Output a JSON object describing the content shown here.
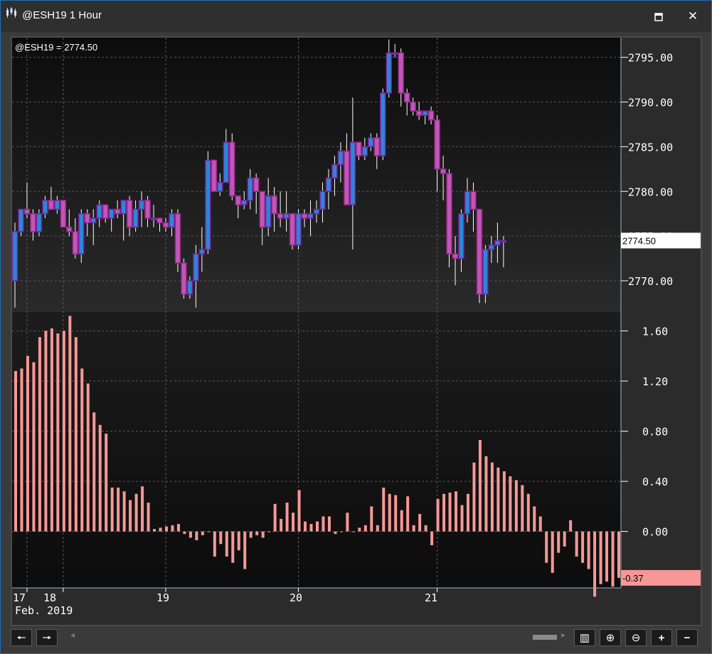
{
  "window": {
    "title": "@ESH19 1 Hour",
    "maximize_glyph": "🗖",
    "close_glyph": "✕",
    "app_icon": "candlestick-app-icon"
  },
  "chart": {
    "symbol_label": "@ESH19 = 2774.50",
    "price_axis_ticks": [
      "2795.00",
      "2790.00",
      "2785.00",
      "2780.00",
      "2775.00",
      "2770.00"
    ],
    "price_marker": "2774.50",
    "indicator_axis_ticks": [
      "1.60",
      "1.20",
      "0.80",
      "0.40",
      "0.00"
    ],
    "indicator_marker": "-0.37",
    "date_labels": [
      "17",
      "18",
      "19",
      "20",
      "21"
    ],
    "month_label": "Feb. 2019",
    "colors": {
      "up_body": "#2c86d9",
      "up_border": "#7a1f9c",
      "down_body": "#c355b8",
      "down_border": "#8f2a85",
      "wick": "#ffffff",
      "histogram": "#f79896",
      "marker_bg": "#ffffff",
      "indicator_marker_bg": "#f79896"
    }
  },
  "chart_data": [
    {
      "type": "candlestick",
      "title": "@ESH19 1 Hour",
      "ylim": [
        2766.5,
        2797.2
      ],
      "last": 2774.5,
      "x_labels": [
        "17",
        "18",
        "19",
        "20",
        "21"
      ],
      "ohlc": [
        [
          2770.0,
          2776.5,
          2767.0,
          2775.5
        ],
        [
          2775.5,
          2778.0,
          2775.0,
          2778.0
        ],
        [
          2778.0,
          2781.0,
          2777.0,
          2777.5
        ],
        [
          2777.5,
          2778.0,
          2774.5,
          2775.5
        ],
        [
          2775.5,
          2778.0,
          2775.0,
          2777.5
        ],
        [
          2777.5,
          2779.5,
          2777.0,
          2779.0
        ],
        [
          2779.0,
          2780.5,
          2778.0,
          2778.0
        ],
        [
          2778.0,
          2779.5,
          2777.5,
          2779.0
        ],
        [
          2779.0,
          2779.0,
          2777.0,
          2776.0
        ],
        [
          2776.0,
          2778.0,
          2775.0,
          2775.5
        ],
        [
          2775.5,
          2777.0,
          2772.5,
          2773.0
        ],
        [
          2773.0,
          2778.0,
          2772.0,
          2777.5
        ],
        [
          2777.5,
          2778.0,
          2775.0,
          2776.5
        ],
        [
          2776.5,
          2778.0,
          2774.0,
          2777.0
        ],
        [
          2777.0,
          2779.0,
          2776.0,
          2778.5
        ],
        [
          2778.5,
          2778.5,
          2776.5,
          2777.0
        ],
        [
          2777.0,
          2778.0,
          2775.5,
          2778.0
        ],
        [
          2778.0,
          2779.0,
          2777.0,
          2777.5
        ],
        [
          2777.5,
          2779.0,
          2774.5,
          2779.0
        ],
        [
          2779.0,
          2779.5,
          2775.0,
          2776.0
        ],
        [
          2776.0,
          2779.0,
          2775.5,
          2778.0
        ],
        [
          2778.0,
          2780.0,
          2776.0,
          2779.0
        ],
        [
          2779.0,
          2779.5,
          2776.0,
          2777.0
        ],
        [
          2777.0,
          2778.5,
          2776.0,
          2777.0
        ],
        [
          2777.0,
          2777.0,
          2775.5,
          2776.5
        ],
        [
          2776.5,
          2777.0,
          2775.5,
          2776.0
        ],
        [
          2776.0,
          2778.0,
          2775.0,
          2777.5
        ],
        [
          2777.5,
          2778.0,
          2771.0,
          2772.0
        ],
        [
          2772.0,
          2772.5,
          2768.0,
          2768.5
        ],
        [
          2768.5,
          2770.5,
          2768.0,
          2770.0
        ],
        [
          2770.0,
          2774.0,
          2767.0,
          2773.0
        ],
        [
          2773.0,
          2776.0,
          2771.0,
          2773.5
        ],
        [
          2773.5,
          2784.5,
          2773.0,
          2783.5
        ],
        [
          2783.5,
          2783.5,
          2780.5,
          2780.0
        ],
        [
          2780.0,
          2782.0,
          2779.5,
          2781.0
        ],
        [
          2781.0,
          2787.0,
          2781.0,
          2785.5
        ],
        [
          2785.5,
          2786.5,
          2779.0,
          2779.5
        ],
        [
          2779.5,
          2779.5,
          2777.0,
          2778.5
        ],
        [
          2778.5,
          2780.0,
          2778.0,
          2779.0
        ],
        [
          2779.0,
          2782.5,
          2778.0,
          2781.5
        ],
        [
          2781.5,
          2782.0,
          2777.5,
          2780.0
        ],
        [
          2780.0,
          2780.0,
          2774.0,
          2776.0
        ],
        [
          2776.0,
          2781.5,
          2775.0,
          2779.5
        ],
        [
          2779.5,
          2780.5,
          2775.5,
          2777.5
        ],
        [
          2777.5,
          2780.0,
          2776.0,
          2777.0
        ],
        [
          2777.0,
          2780.0,
          2775.5,
          2777.5
        ],
        [
          2777.5,
          2777.5,
          2773.5,
          2774.0
        ],
        [
          2774.0,
          2778.0,
          2773.5,
          2777.5
        ],
        [
          2777.5,
          2778.0,
          2776.0,
          2777.0
        ],
        [
          2777.0,
          2779.0,
          2775.0,
          2777.5
        ],
        [
          2777.5,
          2779.0,
          2776.5,
          2778.0
        ],
        [
          2778.0,
          2781.0,
          2776.5,
          2780.0
        ],
        [
          2780.0,
          2782.5,
          2778.0,
          2781.5
        ],
        [
          2781.5,
          2784.0,
          2779.5,
          2783.0
        ],
        [
          2783.0,
          2785.5,
          2781.0,
          2784.5
        ],
        [
          2784.5,
          2786.5,
          2780.0,
          2778.5
        ],
        [
          2778.5,
          2790.5,
          2773.5,
          2785.5
        ],
        [
          2785.5,
          2785.5,
          2783.5,
          2784.0
        ],
        [
          2784.0,
          2786.0,
          2783.5,
          2785.0
        ],
        [
          2785.0,
          2786.5,
          2784.5,
          2786.0
        ],
        [
          2786.0,
          2786.5,
          2782.5,
          2784.0
        ],
        [
          2784.0,
          2791.5,
          2783.5,
          2791.0
        ],
        [
          2791.0,
          2797.0,
          2790.5,
          2795.5
        ],
        [
          2795.5,
          2796.5,
          2795.0,
          2795.5
        ],
        [
          2795.5,
          2796.0,
          2789.5,
          2791.0
        ],
        [
          2791.0,
          2791.5,
          2788.5,
          2790.0
        ],
        [
          2790.0,
          2790.5,
          2788.5,
          2789.0
        ],
        [
          2789.0,
          2790.0,
          2788.0,
          2788.5
        ],
        [
          2788.5,
          2789.0,
          2787.5,
          2789.0
        ],
        [
          2789.0,
          2789.5,
          2787.5,
          2788.0
        ],
        [
          2788.0,
          2788.5,
          2780.0,
          2782.5
        ],
        [
          2782.5,
          2784.0,
          2779.0,
          2782.0
        ],
        [
          2782.0,
          2782.5,
          2771.5,
          2773.0
        ],
        [
          2773.0,
          2775.0,
          2769.5,
          2772.5
        ],
        [
          2772.5,
          2778.0,
          2771.0,
          2777.5
        ],
        [
          2777.5,
          2781.5,
          2776.5,
          2780.0
        ],
        [
          2780.0,
          2781.0,
          2775.5,
          2778.0
        ],
        [
          2778.0,
          2778.0,
          2767.5,
          2768.5
        ],
        [
          2768.5,
          2774.0,
          2767.5,
          2773.5
        ],
        [
          2773.5,
          2775.0,
          2772.0,
          2774.0
        ],
        [
          2774.0,
          2776.5,
          2772.0,
          2774.5
        ],
        [
          2774.5,
          2775.0,
          2771.5,
          2774.5
        ]
      ]
    },
    {
      "type": "bar",
      "title": "",
      "ylim": [
        -0.45,
        1.75
      ],
      "last": -0.37,
      "values": [
        1.28,
        1.3,
        1.4,
        1.35,
        1.55,
        1.6,
        1.62,
        1.58,
        1.6,
        1.72,
        1.55,
        1.3,
        1.18,
        0.95,
        0.85,
        0.78,
        0.35,
        0.35,
        0.32,
        0.25,
        0.3,
        0.36,
        0.23,
        0.02,
        0.03,
        0.04,
        0.05,
        0.06,
        -0.02,
        -0.05,
        -0.07,
        -0.03,
        0.0,
        -0.2,
        -0.1,
        -0.2,
        -0.25,
        -0.15,
        -0.3,
        -0.05,
        -0.03,
        -0.05,
        0.0,
        0.22,
        0.1,
        0.23,
        0.15,
        0.33,
        0.08,
        0.06,
        0.08,
        0.12,
        0.12,
        -0.02,
        0.0,
        0.15,
        0.0,
        0.03,
        0.05,
        0.2,
        0.05,
        0.35,
        0.3,
        0.29,
        0.17,
        0.28,
        0.05,
        0.14,
        0.05,
        -0.11,
        0.26,
        0.3,
        0.31,
        0.32,
        0.21,
        0.3,
        0.55,
        0.73,
        0.6,
        0.55,
        0.51,
        0.48,
        0.44,
        0.41,
        0.37,
        0.3,
        0.2,
        0.12,
        -0.25,
        -0.33,
        -0.17,
        -0.12,
        0.09,
        -0.2,
        -0.25,
        -0.3,
        -0.52,
        -0.42,
        -0.4,
        -0.44,
        -0.37
      ]
    }
  ]
}
